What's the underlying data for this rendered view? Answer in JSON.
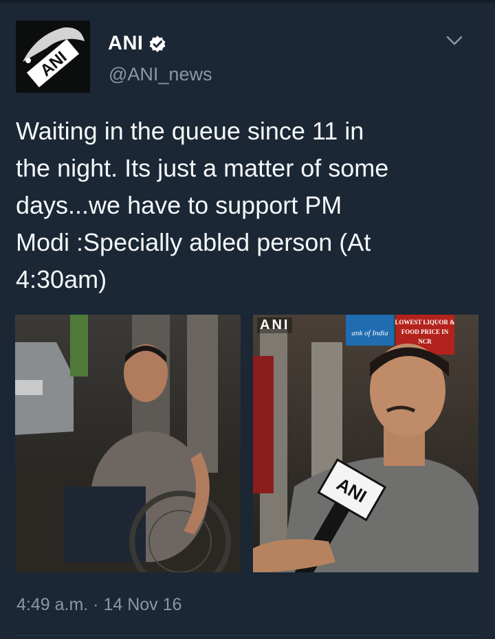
{
  "author": {
    "display_name": "ANI",
    "handle": "@ANI_news",
    "avatar_text": "ANI",
    "verified": true
  },
  "tweet": {
    "text": "Waiting in the queue since 11 in\nthe night. Its just a matter of some\ndays...we have to support PM\nModi :Specially abled person (At\n4:30am)",
    "timestamp": "4:49 a.m. · 14 Nov 16"
  },
  "media": {
    "photo_watermark": "ANI",
    "mic_logo": "ANI",
    "sign_lines": [
      "LOWEST LIQUOR &",
      "FOOD PRICE IN",
      "NCR"
    ],
    "bank_sign": "ank of India"
  },
  "colors": {
    "background": "#1b2734",
    "text_primary": "#f5f8fa",
    "text_secondary": "#8899a6",
    "verified_badge": "#ffffff"
  }
}
